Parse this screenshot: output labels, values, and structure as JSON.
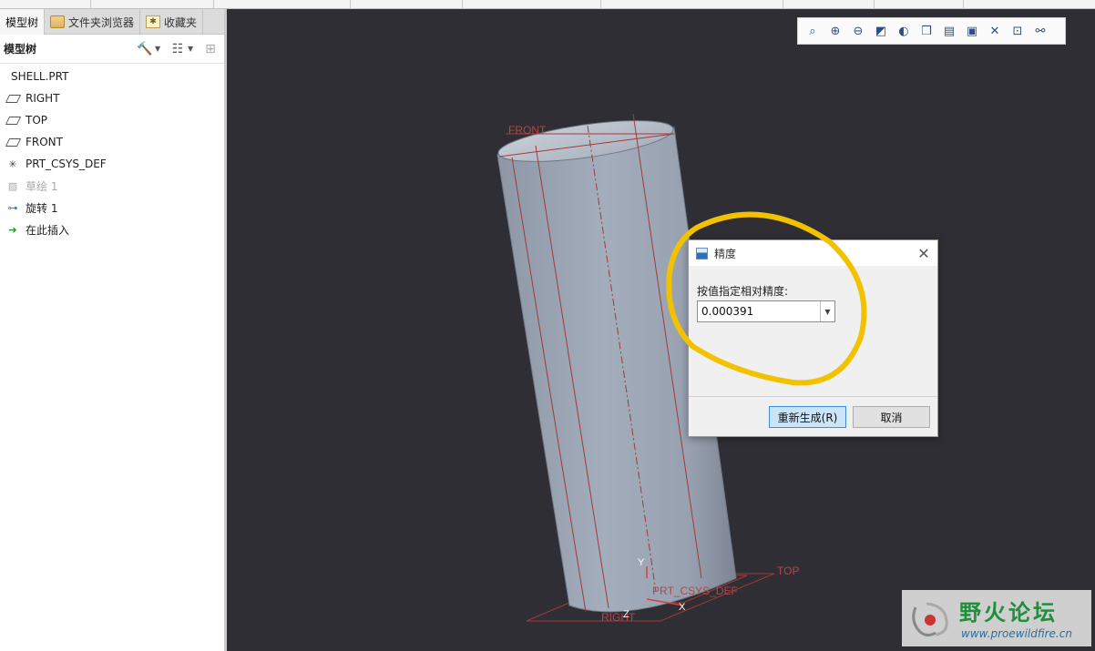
{
  "left_panel": {
    "tabs": [
      {
        "label": "模型树",
        "icon": "model-tree-tab"
      },
      {
        "label": "文件夹浏览器",
        "icon": "folder-icon"
      },
      {
        "label": "收藏夹",
        "icon": "favorites-star-icon"
      }
    ],
    "tree_title": "模型树",
    "tree_items": [
      {
        "label": "SHELL.PRT",
        "icon": "part-icon"
      },
      {
        "label": "RIGHT",
        "icon": "datum-plane-icon"
      },
      {
        "label": "TOP",
        "icon": "datum-plane-icon"
      },
      {
        "label": "FRONT",
        "icon": "datum-plane-icon"
      },
      {
        "label": "PRT_CSYS_DEF",
        "icon": "csys-icon"
      },
      {
        "label": "草绘 1",
        "icon": "sketch-icon",
        "dimmed": true
      },
      {
        "label": "旋转 1",
        "icon": "revolve-icon"
      },
      {
        "label": "在此插入",
        "icon": "insert-arrow-icon"
      }
    ]
  },
  "viewport": {
    "datum_labels": {
      "front": "FRONT",
      "top": "TOP",
      "right": "RIGHT",
      "csys": "PRT_CSYS_DEF",
      "axis_y": "Y",
      "axis_x": "X",
      "axis_z": "Z"
    }
  },
  "dialog": {
    "title": "精度",
    "field_label": "按值指定相对精度:",
    "value": "0.000391",
    "ok_label": "重新生成(R)",
    "cancel_label": "取消",
    "close_symbol": "✕"
  },
  "watermark": {
    "name": "野火论坛",
    "url": "www.proewildfire.cn"
  },
  "colors": {
    "viewport_bg": "#2f2e34",
    "model_fill": "#9ba4b2",
    "datum_color": "#a13a3a",
    "highlight": "#f2c200",
    "primary_button": "#cce4f7"
  }
}
